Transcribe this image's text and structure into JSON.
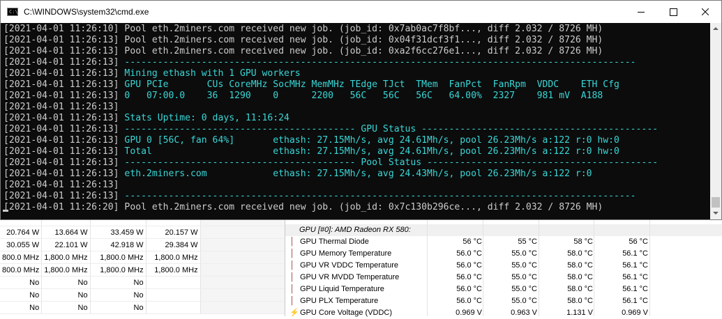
{
  "window": {
    "title": "C:\\WINDOWS\\system32\\cmd.exe",
    "icon": "cmd-icon"
  },
  "console": {
    "lines": [
      {
        "ts": "[2021-04-01 11:26:10]",
        "text": " Pool eth.2miners.com received new job. (job_id: 0x7ab0ac7f8bf..., diff 2.032 / 8726 MH)",
        "color": "gray"
      },
      {
        "ts": "[2021-04-01 11:26:13]",
        "text": " Pool eth.2miners.com received new job. (job_id: 0x04f31dcf3f1..., diff 2.032 / 8726 MH)",
        "color": "gray"
      },
      {
        "ts": "[2021-04-01 11:26:13]",
        "text": " Pool eth.2miners.com received new job. (job_id: 0xa2f6cc276e1..., diff 2.032 / 8726 MH)",
        "color": "gray"
      },
      {
        "ts": "[2021-04-01 11:26:13]",
        "text": " ---------------------------------------------------------------------------------------------",
        "color": "cyan"
      },
      {
        "ts": "[2021-04-01 11:26:13]",
        "text": " Mining ethash with 1 GPU workers",
        "color": "cyan"
      },
      {
        "ts": "[2021-04-01 11:26:13]",
        "text": " GPU PCIe       CUs CoreMHz SocMHz MemMHz TEdge TJct  TMem  FanPct  FanRpm  VDDC    ETH Cfg",
        "color": "cyan"
      },
      {
        "ts": "[2021-04-01 11:26:13]",
        "text": " 0   07:00.0    36  1290    0      2200   56C   56C   56C   64.00%  2327    981 mV  A188",
        "color": "cyan"
      },
      {
        "ts": "[2021-04-01 11:26:13]",
        "text": "",
        "color": "cyan"
      },
      {
        "ts": "[2021-04-01 11:26:13]",
        "text": " Stats Uptime: 0 days, 11:16:24",
        "color": "cyan"
      },
      {
        "ts": "[2021-04-01 11:26:13]",
        "text": " ------------------------------------------ GPU Status -------------------------------------------",
        "color": "cyan"
      },
      {
        "ts": "[2021-04-01 11:26:13]",
        "text": " GPU 0 [56C, fan 64%]       ethash: 27.15Mh/s, avg 24.61Mh/s, pool 26.23Mh/s a:122 r:0 hw:0",
        "color": "cyan"
      },
      {
        "ts": "[2021-04-01 11:26:13]",
        "text": " Total                      ethash: 27.15Mh/s, avg 24.61Mh/s, pool 26.23Mh/s a:122 r:0 hw:0",
        "color": "cyan"
      },
      {
        "ts": "[2021-04-01 11:26:13]",
        "text": " ------------------------------------------ Pool Status ------------------------------------------",
        "color": "cyan"
      },
      {
        "ts": "[2021-04-01 11:26:13]",
        "text": " eth.2miners.com            ethash: 27.15Mh/s, avg 24.43Mh/s, pool 26.23Mh/s a:122 r:0",
        "color": "cyan"
      },
      {
        "ts": "[2021-04-01 11:26:13]",
        "text": "",
        "color": "cyan"
      },
      {
        "ts": "[2021-04-01 11:26:13]",
        "text": " ---------------------------------------------------------------------------------------------",
        "color": "cyan"
      },
      {
        "ts": "[2021-04-01 11:26:20]",
        "text": " Pool eth.2miners.com received new job. (job_id: 0x7c130b296ce..., diff 2.032 / 8726 MH)",
        "color": "gray"
      }
    ]
  },
  "left_table": {
    "rows": [
      [
        "20.764 W",
        "13.664 W",
        "33.459 W",
        "20.157 W"
      ],
      [
        "30.055 W",
        "22.101 W",
        "42.918 W",
        "29.384 W"
      ],
      [
        "800.0 MHz",
        "1,800.0 MHz",
        "1,800.0 MHz",
        "1,800.0 MHz"
      ],
      [
        "800.0 MHz",
        "1,800.0 MHz",
        "1,800.0 MHz",
        "1,800.0 MHz"
      ],
      [
        "No",
        "No",
        "No",
        ""
      ],
      [
        "No",
        "No",
        "No",
        ""
      ],
      [
        "No",
        "No",
        "No",
        ""
      ]
    ]
  },
  "right_panel": {
    "group_label": "GPU [#0]: AMD Radeon RX 580:",
    "sensors": [
      {
        "name": "GPU Thermal Diode",
        "vals": [
          "56 °C",
          "55 °C",
          "58 °C",
          "56 °C"
        ],
        "icon": "thermometer-icon"
      },
      {
        "name": "GPU Memory Temperature",
        "vals": [
          "56.0 °C",
          "55.0 °C",
          "58.0 °C",
          "56.1 °C"
        ],
        "icon": "thermometer-icon"
      },
      {
        "name": "GPU VR VDDC Temperature",
        "vals": [
          "56.0 °C",
          "55.0 °C",
          "58.0 °C",
          "56.1 °C"
        ],
        "icon": "thermometer-icon"
      },
      {
        "name": "GPU VR MVDD Temperature",
        "vals": [
          "56.0 °C",
          "55.0 °C",
          "58.0 °C",
          "56.1 °C"
        ],
        "icon": "thermometer-icon"
      },
      {
        "name": "GPU Liquid Temperature",
        "vals": [
          "56.0 °C",
          "55.0 °C",
          "58.0 °C",
          "56.1 °C"
        ],
        "icon": "thermometer-icon"
      },
      {
        "name": "GPU PLX Temperature",
        "vals": [
          "56.0 °C",
          "55.0 °C",
          "58.0 °C",
          "56.1 °C"
        ],
        "icon": "thermometer-icon"
      },
      {
        "name": "GPU Core Voltage (VDDC)",
        "vals": [
          "0.969 V",
          "0.963 V",
          "1.131 V",
          "0.969 V"
        ],
        "icon": "voltage-icon"
      }
    ]
  },
  "colors": {
    "console_bg": "#0c0c0c",
    "console_text": "#cccccc",
    "console_cyan": "#3ad6d6"
  }
}
